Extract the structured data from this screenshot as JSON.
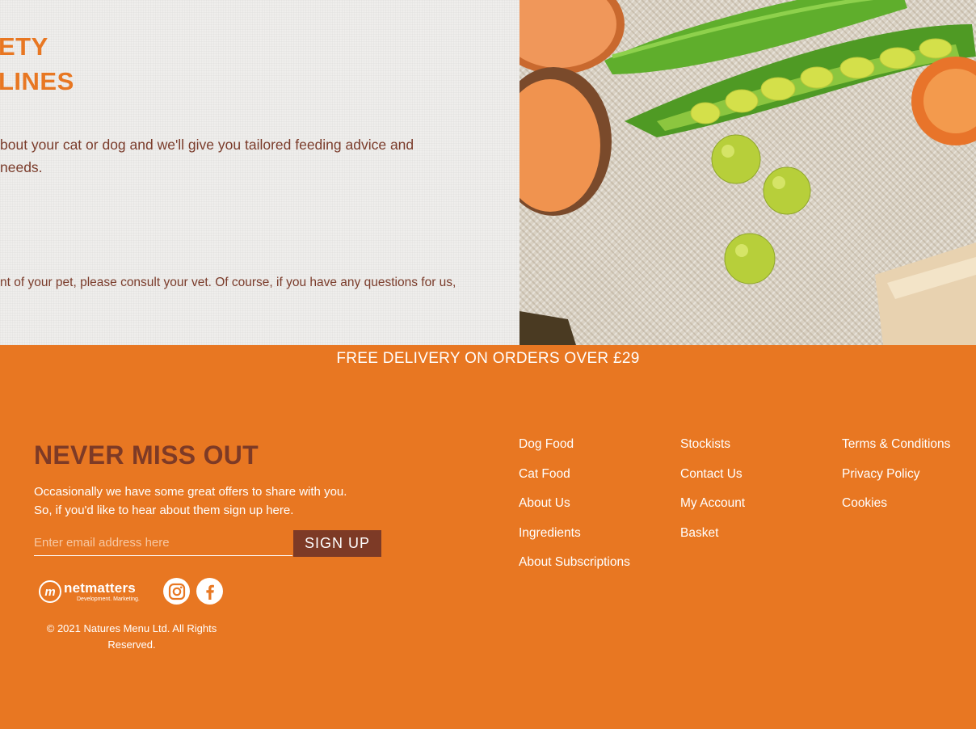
{
  "hero": {
    "heading_line1": "ETY",
    "heading_line2": "LINES",
    "paragraph_line1": "bout your cat or dog and we'll give you tailored feeding advice and",
    "paragraph_line2": "needs.",
    "disclaimer": "nt of your pet, please consult your vet. Of course, if you have any questions for us,"
  },
  "footer": {
    "delivery_banner": "FREE DELIVERY ON ORDERS OVER £29",
    "newsletter": {
      "title": "NEVER MISS OUT",
      "description_line1": "Occasionally we have some great offers to share with you.",
      "description_line2": "So, if you'd like to hear about them sign up here.",
      "email_placeholder": "Enter email address here",
      "signup_label": "SIGN UP"
    },
    "agency_logo": {
      "mark": "m",
      "name": "netmatters",
      "tagline": "Development. Marketing."
    },
    "social_icons": [
      "instagram-icon",
      "facebook-icon"
    ],
    "copyright": "© 2021 Natures Menu Ltd. All Rights Reserved.",
    "link_columns": [
      [
        "Dog Food",
        "Cat Food",
        "About Us",
        "Ingredients",
        "About Subscriptions"
      ],
      [
        "Stockists",
        "Contact Us",
        "My Account",
        "Basket"
      ],
      [
        "Terms & Conditions",
        "Privacy Policy",
        "Cookies"
      ]
    ]
  },
  "colors": {
    "brand_orange": "#e87722",
    "brand_brown": "#7d3a26",
    "text_brown": "#7a3b2a",
    "white": "#ffffff"
  }
}
